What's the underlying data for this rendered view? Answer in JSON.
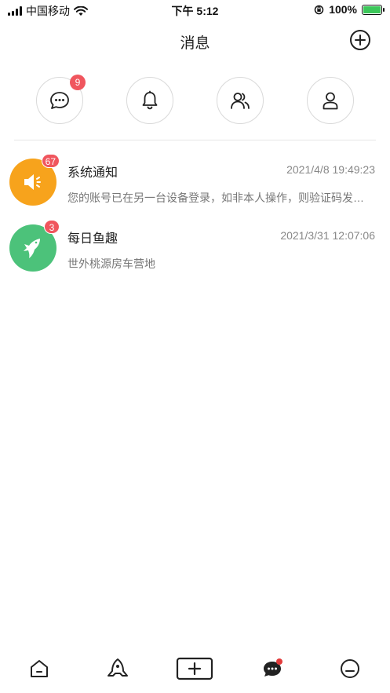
{
  "status_bar": {
    "carrier": "中国移动",
    "time": "下午 5:12",
    "battery": "100%"
  },
  "header": {
    "title": "消息"
  },
  "quick_actions": [
    {
      "icon": "chat-bubble-icon",
      "badge": "9"
    },
    {
      "icon": "bell-icon",
      "badge": ""
    },
    {
      "icon": "group-icon",
      "badge": ""
    },
    {
      "icon": "person-icon",
      "badge": ""
    }
  ],
  "messages": [
    {
      "name": "系统通知",
      "time": "2021/4/8 19:49:23",
      "preview": "您的账号已在另一台设备登录，如非本人操作，则验证码发…",
      "badge": "67",
      "avatar_color": "#f7a31c",
      "icon": "megaphone-icon"
    },
    {
      "name": "每日鱼趣",
      "time": "2021/3/31 12:07:06",
      "preview": "世外桃源房车营地",
      "badge": "3",
      "avatar_color": "#4cc27a",
      "icon": "fish-icon"
    }
  ],
  "bottom_nav": [
    {
      "icon": "home-icon"
    },
    {
      "icon": "rocket-icon"
    },
    {
      "icon": "add-post-icon"
    },
    {
      "icon": "message-icon"
    },
    {
      "icon": "profile-icon"
    }
  ],
  "colors": {
    "badge": "#f0565e",
    "battery": "#3cc75a"
  }
}
